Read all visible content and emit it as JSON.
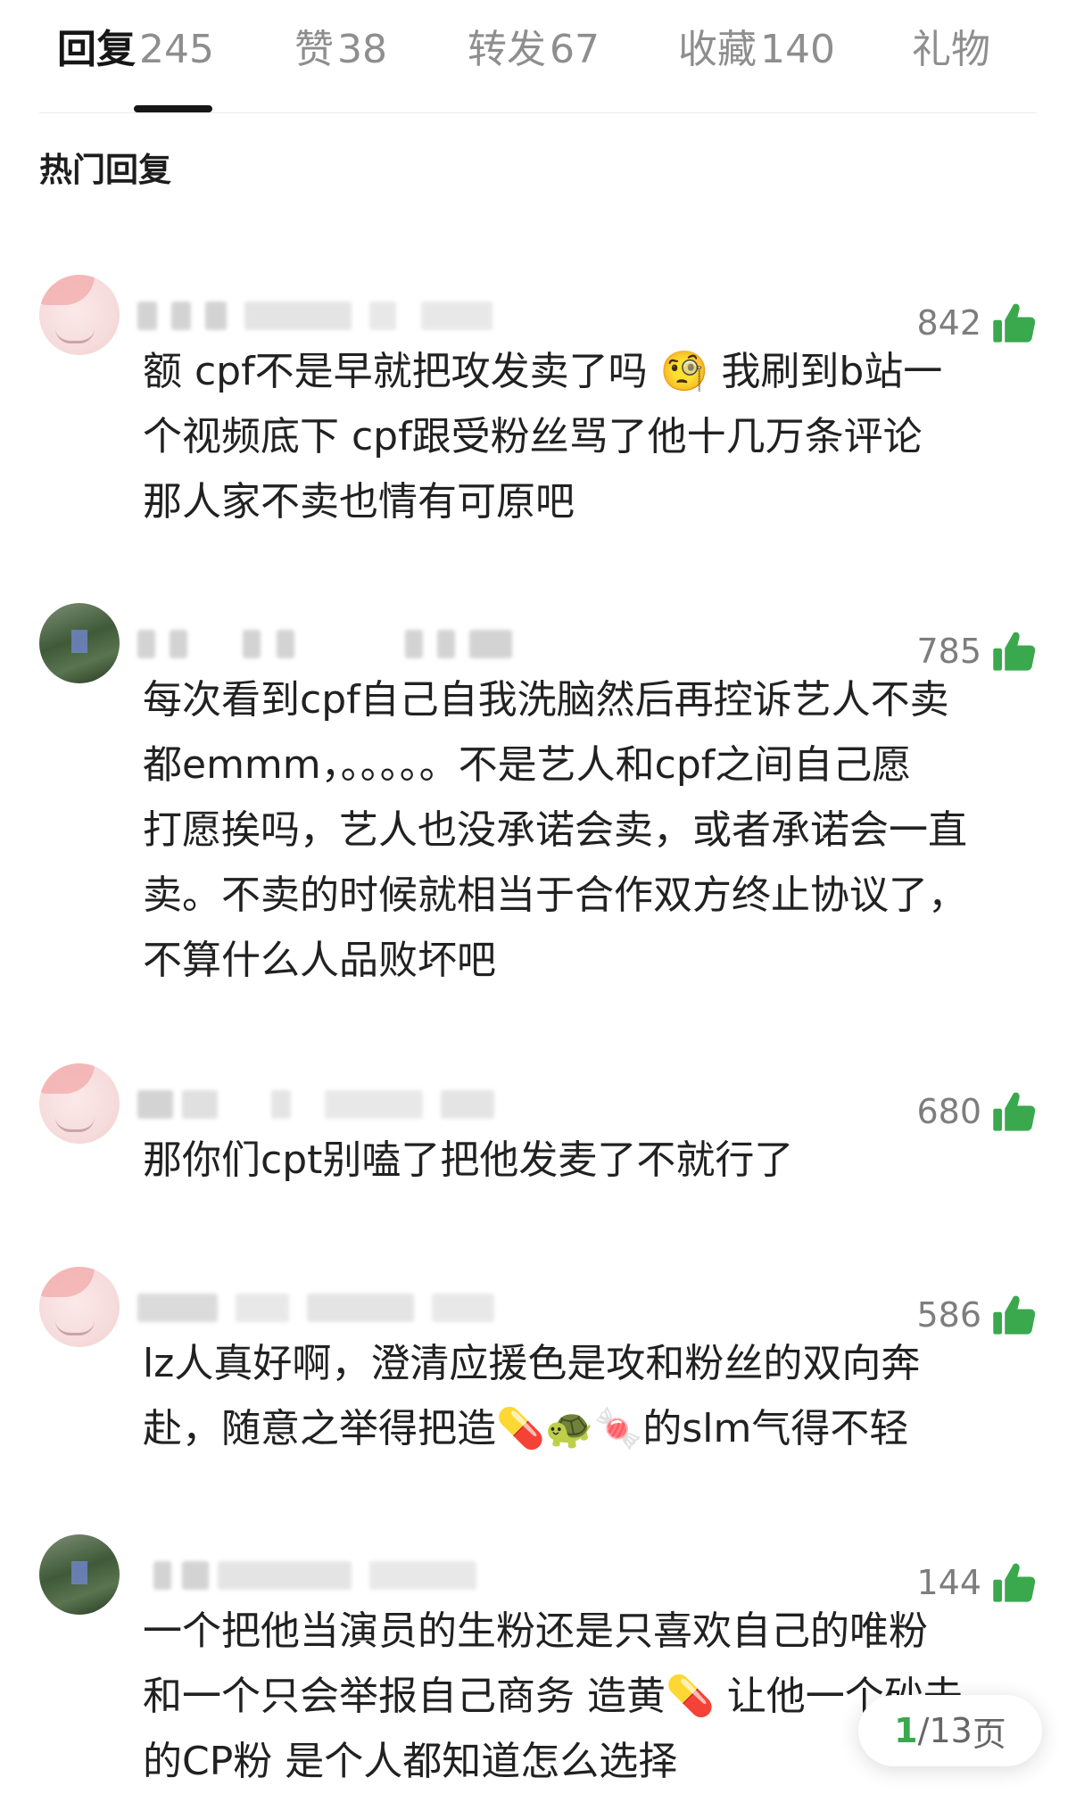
{
  "tabs": [
    {
      "name": "回复",
      "count": "245",
      "active": true
    },
    {
      "name": "赞",
      "count": "38"
    },
    {
      "name": "转发",
      "count": "67"
    },
    {
      "name": "收藏",
      "count": "140"
    },
    {
      "name": "礼物",
      "count": ""
    }
  ],
  "section_title": "热门回复",
  "comments": [
    {
      "likes": "842",
      "avatar": "pink",
      "lines": [
        "额 cpf不是早就把攻发卖了吗 🧐 我刷到b站一",
        "个视频底下 cpf跟受粉丝骂了他十几万条评论",
        "那人家不卖也情有可原吧"
      ]
    },
    {
      "likes": "785",
      "avatar": "green",
      "lines": [
        "每次看到cpf自己自我洗脑然后再控诉艺人不卖",
        "都emmm，。。。。。不是艺人和cpf之间自己愿",
        "打愿挨吗，艺人也没承诺会卖，或者承诺会一直",
        "卖。不卖的时候就相当于合作双方终止协议了，",
        "不算什么人品败坏吧"
      ]
    },
    {
      "likes": "680",
      "avatar": "pink",
      "lines": [
        "那你们cpt别嗑了把他发麦了不就行了"
      ]
    },
    {
      "likes": "586",
      "avatar": "pink",
      "lines": [
        "lz人真好啊，澄清应援色是攻和粉丝的双向奔",
        "赴，随意之举得把造💊🐢🍬的slm气得不轻"
      ]
    },
    {
      "likes": "144",
      "avatar": "green",
      "lines": [
        "一个把他当演员的生粉还是只喜欢自己的唯粉",
        "和一个只会举报自己商务 造黄💊 让他一个砂去",
        "的CP粉 是个人都知道怎么选择"
      ]
    }
  ],
  "pager": {
    "current": "1",
    "total": "13",
    "unit": "页"
  },
  "colors": {
    "like": "#3aa84d",
    "active_tab": "#161616",
    "muted": "#8e8e8e"
  }
}
